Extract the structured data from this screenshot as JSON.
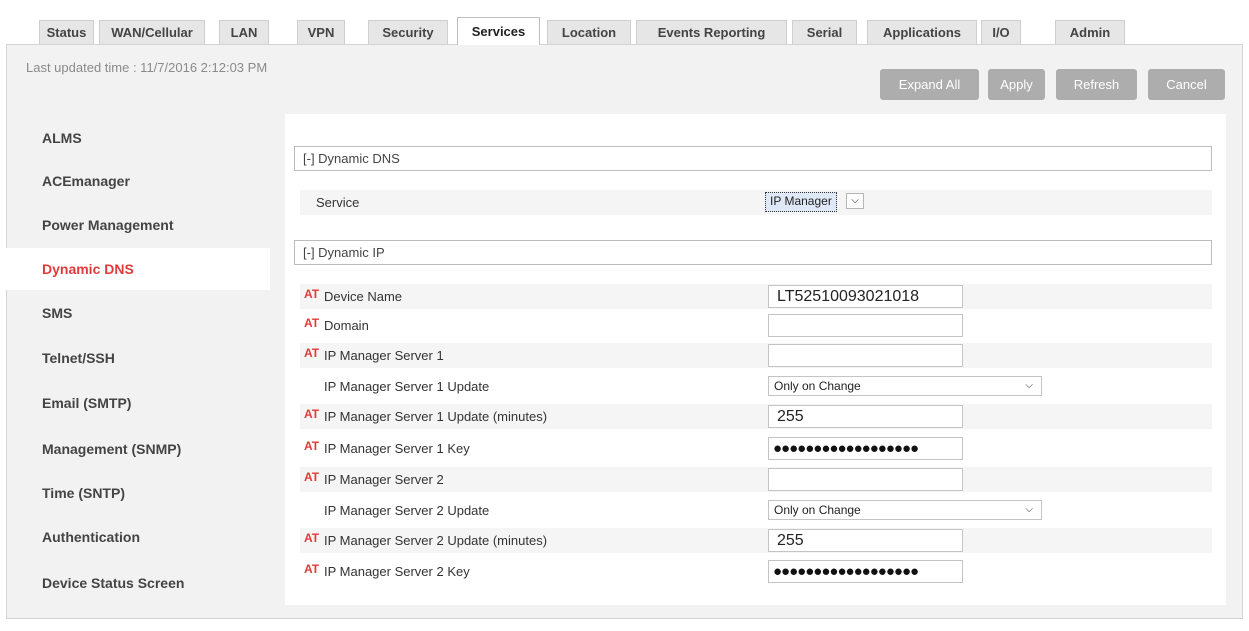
{
  "tabs": [
    {
      "label": "Status",
      "active": false
    },
    {
      "label": "WAN/Cellular",
      "active": false
    },
    {
      "label": "LAN",
      "active": false
    },
    {
      "label": "VPN",
      "active": false
    },
    {
      "label": "Security",
      "active": false
    },
    {
      "label": "Services",
      "active": true
    },
    {
      "label": "Location",
      "active": false
    },
    {
      "label": "Events Reporting",
      "active": false
    },
    {
      "label": "Serial",
      "active": false
    },
    {
      "label": "Applications",
      "active": false
    },
    {
      "label": "I/O",
      "active": false
    },
    {
      "label": "Admin",
      "active": false
    }
  ],
  "last_updated": "Last updated time : 11/7/2016 2:12:03 PM",
  "toolbar": {
    "expand_all": "Expand All",
    "apply": "Apply",
    "refresh": "Refresh",
    "cancel": "Cancel"
  },
  "sidebar": {
    "items": [
      {
        "label": "ALMS",
        "active": false
      },
      {
        "label": "ACEmanager",
        "active": false
      },
      {
        "label": "Power Management",
        "active": false
      },
      {
        "label": "Dynamic DNS",
        "active": true
      },
      {
        "label": "SMS",
        "active": false
      },
      {
        "label": "Telnet/SSH",
        "active": false
      },
      {
        "label": "Email (SMTP)",
        "active": false
      },
      {
        "label": "Management (SNMP)",
        "active": false
      },
      {
        "label": "Time (SNTP)",
        "active": false
      },
      {
        "label": "Authentication",
        "active": false
      },
      {
        "label": "Device Status Screen",
        "active": false
      }
    ]
  },
  "dynamic_dns": {
    "header": "[-] Dynamic DNS",
    "service_label": "Service",
    "service_value": "IP Manager"
  },
  "dynamic_ip": {
    "header": "[-] Dynamic IP",
    "at_marker": "AT",
    "fields": {
      "device_name": {
        "label": "Device Name",
        "value": "LT52510093021018"
      },
      "domain": {
        "label": "Domain",
        "value": ""
      },
      "server1": {
        "label": "IP Manager Server 1",
        "value": ""
      },
      "server1_update": {
        "label": "IP Manager Server 1 Update",
        "value": "Only on Change"
      },
      "server1_update_minutes": {
        "label": "IP Manager Server 1 Update (minutes)",
        "value": "255"
      },
      "server1_key": {
        "label": "IP Manager Server 1 Key",
        "value": "●●●●●●●●●●●●●●●●●●"
      },
      "server2": {
        "label": "IP Manager Server 2",
        "value": ""
      },
      "server2_update": {
        "label": "IP Manager Server 2 Update",
        "value": "Only on Change"
      },
      "server2_update_minutes": {
        "label": "IP Manager Server 2 Update (minutes)",
        "value": "255"
      },
      "server2_key": {
        "label": "IP Manager Server 2 Key",
        "value": "●●●●●●●●●●●●●●●●●●"
      }
    }
  },
  "colors": {
    "accent_red": "#e03a3a",
    "button_gray": "#adadad",
    "frame_bg": "#f2f2f2"
  }
}
